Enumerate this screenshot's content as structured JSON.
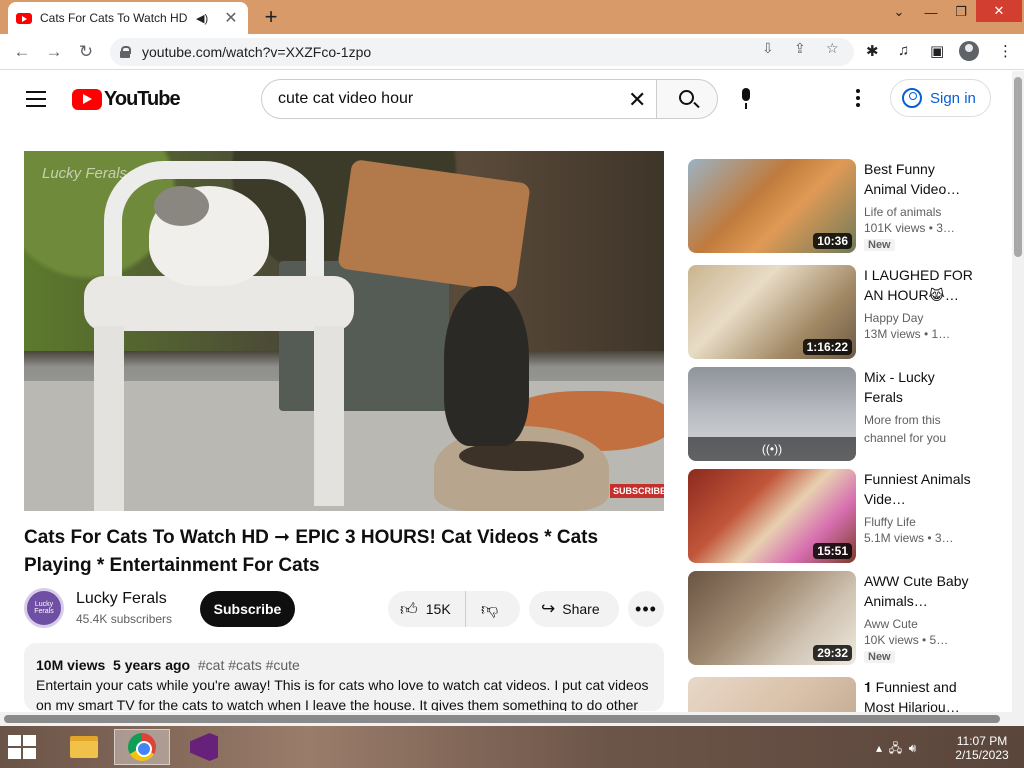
{
  "browser": {
    "tab_title": "Cats For Cats To Watch HD ~",
    "tab_audio_icon": "speaker-icon",
    "url": "youtube.com/watch?v=XXZFco-1zpo"
  },
  "youtube": {
    "logo_text": "YouTube",
    "search_query": "cute cat video hour",
    "sign_in_label": "Sign in"
  },
  "video": {
    "title": "Cats For Cats To Watch HD ➞ EPIC 3 HOURS! Cat Videos * Cats Playing * Entertainment For Cats",
    "watermark": "Lucky Ferals",
    "subscribe_watermark": "SUBSCRIBE",
    "channel": {
      "name": "Lucky Ferals",
      "subscribers": "45.4K subscribers",
      "avatar_text": "Lucky Ferals"
    },
    "subscribe_label": "Subscribe",
    "likes": "15K",
    "share_label": "Share",
    "description": {
      "views": "10M views",
      "age": "5 years ago",
      "tags": "#cat #cats #cute",
      "text": "Entertain your cats while you're away! This is for cats who love to watch cat videos. I put cat videos on my smart TV for the cats to watch when I leave the house. It gives them something to do other"
    }
  },
  "related": [
    {
      "title": "Best Funny Animal Video…",
      "channel": "Life of animals",
      "views": "101K views  • 3…",
      "duration": "10:36",
      "badge": "New"
    },
    {
      "title": "I LAUGHED FOR AN HOUR😹…",
      "channel": "Happy Day",
      "views": "13M views  • 1…",
      "duration": "1:16:22",
      "badge": ""
    },
    {
      "title": "Mix - Lucky Ferals",
      "channel": "More from this channel for you",
      "views": "",
      "duration": "",
      "badge": "",
      "mix_icon": "((•))"
    },
    {
      "title": "Funniest Animals Vide…",
      "channel": "Fluffy Life",
      "views": "5.1M views  • 3…",
      "duration": "15:51",
      "badge": ""
    },
    {
      "title": "AWW Cute Baby Animals…",
      "channel": "Aww Cute",
      "views": "10K views  • 5…",
      "duration": "29:32",
      "badge": "New"
    },
    {
      "title": "𝟏 Funniest and Most Hilariou…",
      "channel": "",
      "views": "",
      "duration": "",
      "badge": ""
    }
  ],
  "taskbar": {
    "time": "11:07 PM",
    "date": "2/15/2023"
  },
  "colors": {
    "youtube_red": "#ff0000",
    "link_blue": "#065fd4",
    "tabstrip": "#d99a6a"
  }
}
